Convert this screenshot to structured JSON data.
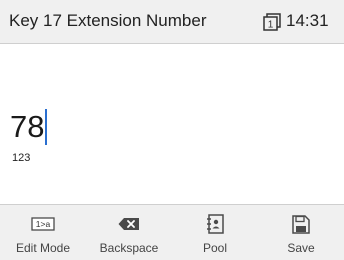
{
  "header": {
    "title": "Key 17 Extension Number",
    "line_indicator": "1",
    "line_icon": "line-key-icon",
    "time": "14:31"
  },
  "input": {
    "value": "78",
    "mode": "123"
  },
  "softkeys": [
    {
      "label": "Edit Mode",
      "icon": "edit-mode-icon",
      "icon_text": "1>a"
    },
    {
      "label": "Backspace",
      "icon": "backspace-icon"
    },
    {
      "label": "Pool",
      "icon": "directory-icon"
    },
    {
      "label": "Save",
      "icon": "save-icon"
    }
  ],
  "colors": {
    "caret": "#2a6fd0",
    "bar_background": "#f0f0f0",
    "icon": "#4a4a4a"
  }
}
